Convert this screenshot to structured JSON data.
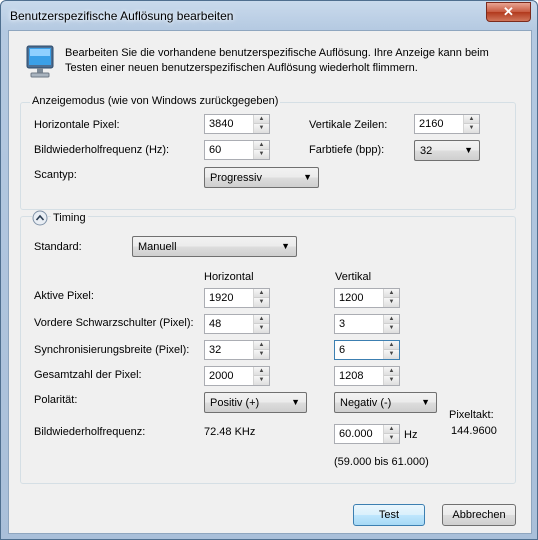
{
  "window": {
    "title": "Benutzerspezifische Auflösung bearbeiten",
    "close_glyph": "✕"
  },
  "intro": {
    "line1": "Bearbeiten Sie die vorhandene benutzerspezifische Auflösung. Ihre Anzeige kann beim",
    "line2": "Testen einer neuen benutzerspezifischen Auflösung wiederholt flimmern.",
    "icon": "monitor-icon"
  },
  "display_mode": {
    "group_title": "Anzeigemodus (wie von Windows zurückgegeben)",
    "h_pixels": {
      "label": "Horizontale Pixel:",
      "value": "3840"
    },
    "v_lines": {
      "label": "Vertikale Zeilen:",
      "value": "2160"
    },
    "refresh": {
      "label": "Bildwiederholfrequenz (Hz):",
      "value": "60"
    },
    "color_depth": {
      "label": "Farbtiefe (bpp):",
      "value": "32"
    },
    "scan_type": {
      "label": "Scantyp:",
      "value": "Progressiv"
    }
  },
  "timing": {
    "toggle_label": "Timing",
    "standard": {
      "label": "Standard:",
      "value": "Manuell"
    },
    "col_horizontal": "Horizontal",
    "col_vertical": "Vertikal",
    "rows": [
      {
        "label": "Aktive Pixel:",
        "h": "1920",
        "v": "1200"
      },
      {
        "label": "Vordere Schwarzschulter (Pixel):",
        "h": "48",
        "v": "3"
      },
      {
        "label": "Synchronisierungsbreite (Pixel):",
        "h": "32",
        "v": "6"
      },
      {
        "label": "Gesamtzahl der Pixel:",
        "h": "2000",
        "v": "1208"
      }
    ],
    "polarity": {
      "label": "Polarität:",
      "h": "Positiv (+)",
      "v": "Negativ (-)"
    },
    "refresh": {
      "label": "Bildwiederholfrequenz:",
      "h_value": "72.48 KHz",
      "v_value": "60.000",
      "unit": "Hz",
      "range": "(59.000 bis 61.000)"
    },
    "pixel_clock": {
      "label": "Pixeltakt:",
      "value": "144.9600"
    }
  },
  "buttons": {
    "test": "Test",
    "cancel": "Abbrechen"
  }
}
